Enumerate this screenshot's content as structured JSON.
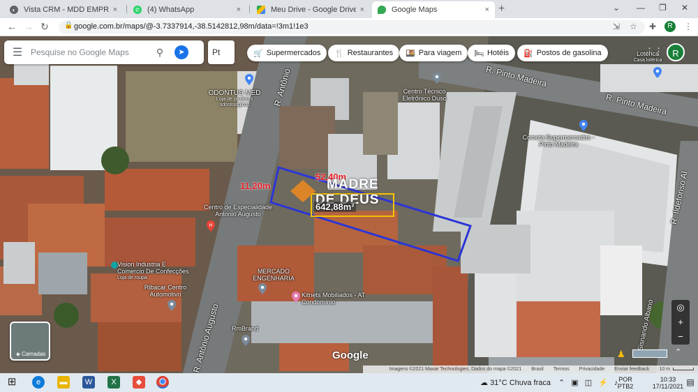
{
  "browser": {
    "tabs": [
      {
        "title": "Vista CRM - MDD EMPREENDIME",
        "close": "×",
        "icon": "crm-icon",
        "color": "#5f6368"
      },
      {
        "title": "(4) WhatsApp",
        "close": "×",
        "icon": "whatsapp-icon",
        "color": "#25d366"
      },
      {
        "title": "Meu Drive - Google Drive",
        "close": "×",
        "icon": "drive-icon",
        "color": "#fbbc04"
      },
      {
        "title": "Google Maps",
        "close": "×",
        "icon": "maps-icon",
        "color": "#34a853"
      }
    ],
    "new_tab": "+",
    "window_controls": {
      "menu": "⌄",
      "minimize": "—",
      "maximize": "❐",
      "close": "✕"
    },
    "nav": {
      "back": "←",
      "forward": "→",
      "reload": "↻"
    },
    "url": "google.com.br/maps/@-3.7337914,-38.5142812,98m/data=!3m1!1e3",
    "profile_initial": "R"
  },
  "maps": {
    "search_placeholder": "Pesquise no Google Maps",
    "lang_button": "Pt",
    "chips": [
      {
        "label": "Supermercados",
        "icon": "cart-icon",
        "glyph": "🛒"
      },
      {
        "label": "Restaurantes",
        "icon": "fork-knife-icon",
        "glyph": "🍴"
      },
      {
        "label": "Para viagem",
        "icon": "takeout-icon",
        "glyph": "🍱"
      },
      {
        "label": "Hotéis",
        "icon": "bed-icon",
        "glyph": "🛏"
      },
      {
        "label": "Postos de gasolina",
        "icon": "gas-station-icon",
        "glyph": "⛽"
      }
    ],
    "profile_initial": "R",
    "streets": {
      "r_antonio_top": "R. Antônio",
      "r_antonio_bottom": "R. Antônio Augusto",
      "pinto_madeira_1": "R. Pinto Madeira",
      "pinto_madeira_2": "R. Pinto Madeira",
      "ildefonso": "R. Ildefonso Al",
      "sisnando": "Sisnando Albano"
    },
    "pois": {
      "odontus": "ODONTUS MED",
      "odontus_sub": "Loja de produtos odontológicos",
      "centro_tecnico": "Centro Técnico Eletrônico Duso",
      "cometa": "Cometa Supermercados - Pinto Madeira",
      "centro_esp": "Centro de Especialidade Antonio Augusto",
      "vision": "Vision Industria E Comercio De Confecções",
      "vision_sub": "Loja de roupa",
      "ribacar": "Ribacar Centro Automotivo",
      "mercado": "MERCADO ENGENHARIA",
      "kitnets": "Kitnets Mobiliados - AT Condomínio",
      "rmbrand": "RmBrand",
      "lotericas": "Lotérica",
      "lotericas_sub": "Casa lotérica"
    },
    "overlay": {
      "dim_top": "52,40m",
      "dim_left": "11,20m",
      "area": "642,88m²",
      "watermark_line1": "MADRE",
      "watermark_line2": "DE DEUS",
      "line_color": "#2b35d6",
      "area_box_color": "#f5c400",
      "dim_color": "#e8202a"
    },
    "layers_label": "Camadas",
    "zoom_in": "+",
    "zoom_out": "−",
    "google_logo": "Google",
    "attribution": [
      "Imagens ©2021 Maxar Technologies, Dados do mapa ©2021",
      "Brasil",
      "Termos",
      "Privacidade",
      "Enviar feedback",
      "10 m"
    ]
  },
  "taskbar": {
    "apps": [
      {
        "name": "start-button",
        "glyph": "⊞",
        "color": "#1f1f1f"
      },
      {
        "name": "edge-icon",
        "glyph": "e",
        "color": "#0c7bd9"
      },
      {
        "name": "file-explorer-icon",
        "glyph": "▬",
        "color": "#e8b400"
      },
      {
        "name": "word-icon",
        "glyph": "W",
        "color": "#2b579a"
      },
      {
        "name": "excel-icon",
        "glyph": "X",
        "color": "#217346"
      },
      {
        "name": "anydesk-icon",
        "glyph": "◆",
        "color": "#e74c3c"
      },
      {
        "name": "chrome-icon",
        "glyph": "◉",
        "color": "#db4437"
      }
    ],
    "weather": "31°C  Chuva fraca",
    "lang": "POR",
    "lang2": "PTB2",
    "time": "10:33",
    "date": "17/11/2021"
  }
}
